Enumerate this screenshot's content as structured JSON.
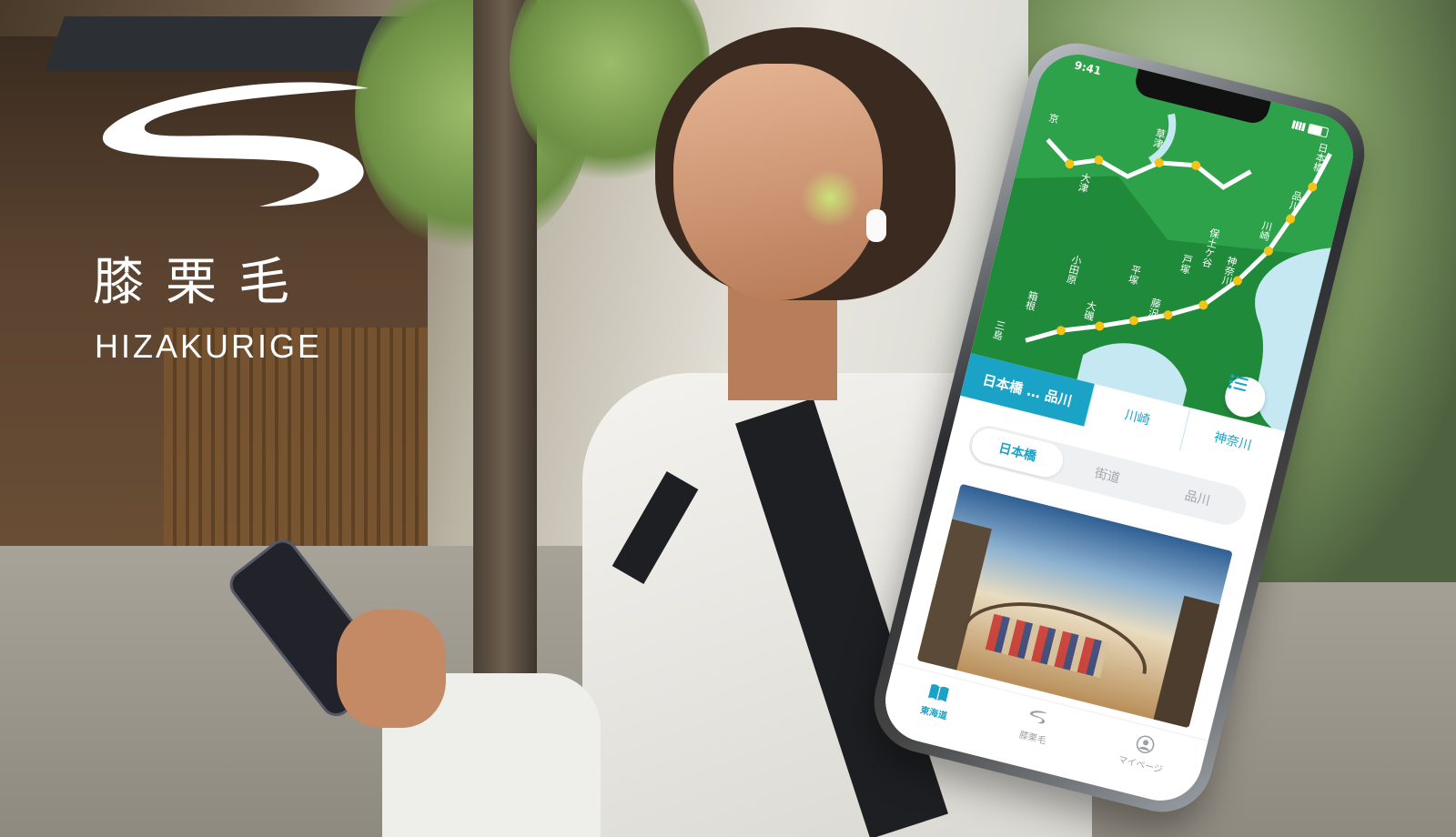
{
  "brand": {
    "kanji": "膝栗毛",
    "romaji": "HIZAKURIGE"
  },
  "colors": {
    "accent": "#1aa3c7",
    "map_green": "#1f8b3a",
    "route_yellow": "#f3c316"
  },
  "phone": {
    "status_time": "9:41",
    "map": {
      "stations": [
        "京",
        "草津",
        "大津",
        "日本橋",
        "品川",
        "川崎",
        "保土ケ谷",
        "神奈川",
        "戸塚",
        "藤沢",
        "平塚",
        "大磯",
        "小田原",
        "箱根",
        "三島"
      ],
      "list_button_icon": "list-icon"
    },
    "segment_tabs": {
      "active": "日本橋 … 品川",
      "items": [
        "川崎",
        "神奈川"
      ]
    },
    "pill_tabs": [
      "日本橋",
      "街道",
      "品川"
    ],
    "pill_active_index": 0,
    "tab_bar": [
      {
        "label": "東海道",
        "icon": "book-icon",
        "active": true
      },
      {
        "label": "膝栗毛",
        "icon": "logo-s-icon",
        "active": false
      },
      {
        "label": "マイページ",
        "icon": "profile-icon",
        "active": false
      }
    ]
  }
}
